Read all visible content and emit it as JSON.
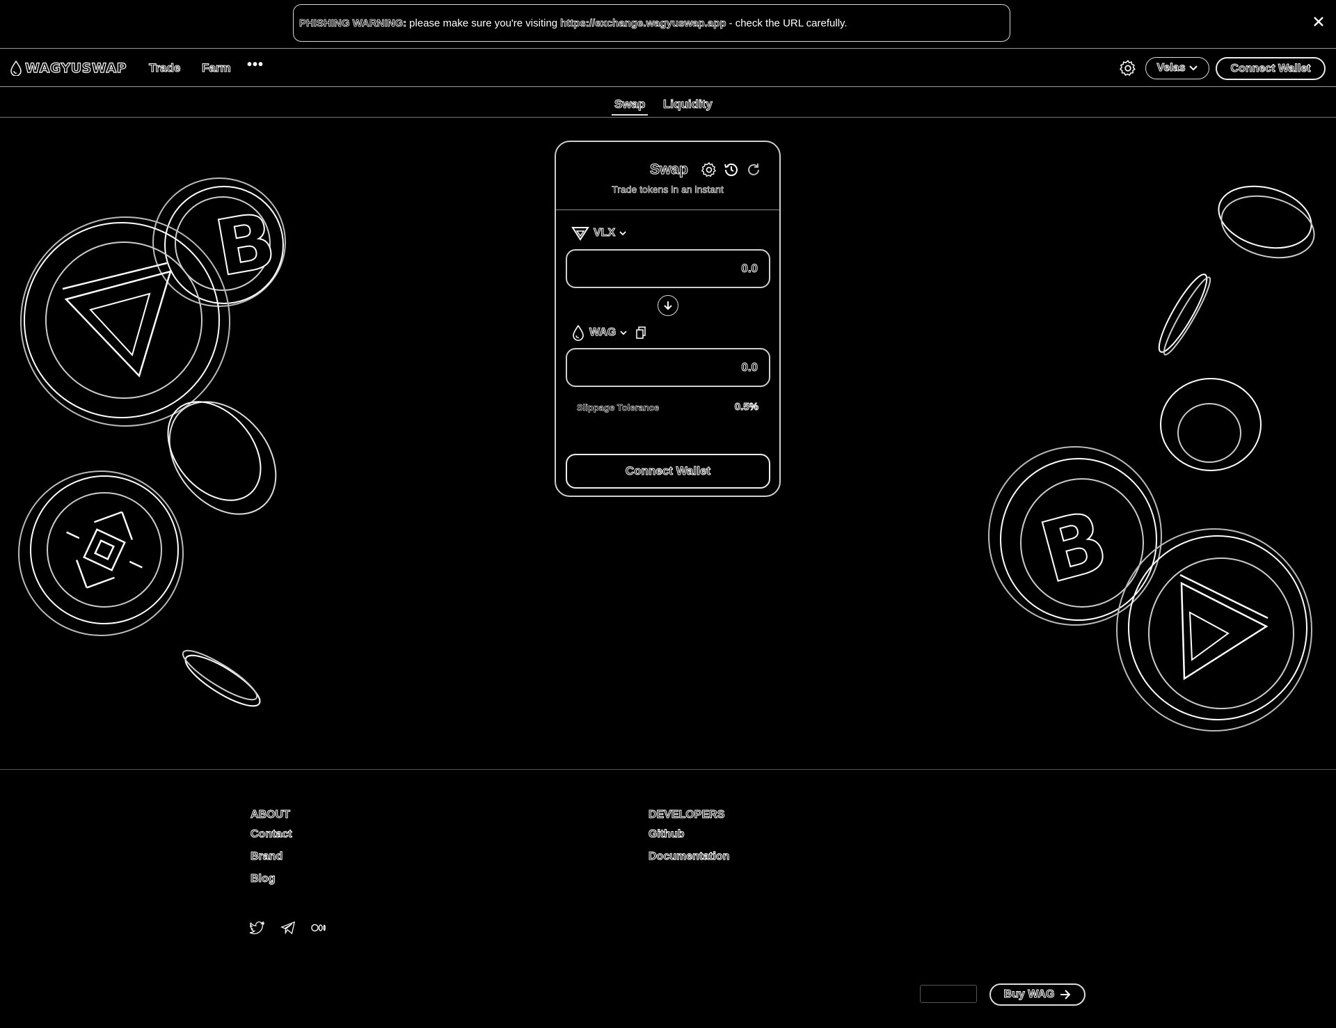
{
  "banner": {
    "warning_label": "PHISHING WARNING:",
    "text_before": "please make sure you're visiting",
    "url": "https://exchange.wagyuswap.app",
    "text_after": "- check the URL carefully."
  },
  "nav": {
    "logo_text": "WAGYUSWAP",
    "links": [
      {
        "label": "Trade"
      },
      {
        "label": "Farm"
      }
    ],
    "more": "•••",
    "language": "Velas",
    "connect_label": "Connect Wallet"
  },
  "tabs": [
    {
      "label": "Swap",
      "active": true
    },
    {
      "label": "Liquidity",
      "active": false
    }
  ],
  "swap": {
    "title": "Swap",
    "subtitle": "Trade tokens in an instant",
    "from_token": "VLX",
    "from_amount_placeholder": "0.0",
    "to_token": "WAG",
    "to_amount_placeholder": "0.0",
    "slippage_label": "Slippage Tolerance",
    "slippage_value": "0.5%",
    "connect_label": "Connect Wallet"
  },
  "footer": {
    "about": {
      "title": "ABOUT",
      "links": [
        "Contact",
        "Brand",
        "Blog"
      ]
    },
    "developers": {
      "title": "DEVELOPERS",
      "links": [
        "Github",
        "Documentation"
      ]
    },
    "social_icons": [
      "twitter-icon",
      "telegram-icon",
      "medium-icon"
    ],
    "buy_label": "Buy WAG"
  },
  "colors": {
    "background": "#000000",
    "outline": "#ffffff"
  }
}
